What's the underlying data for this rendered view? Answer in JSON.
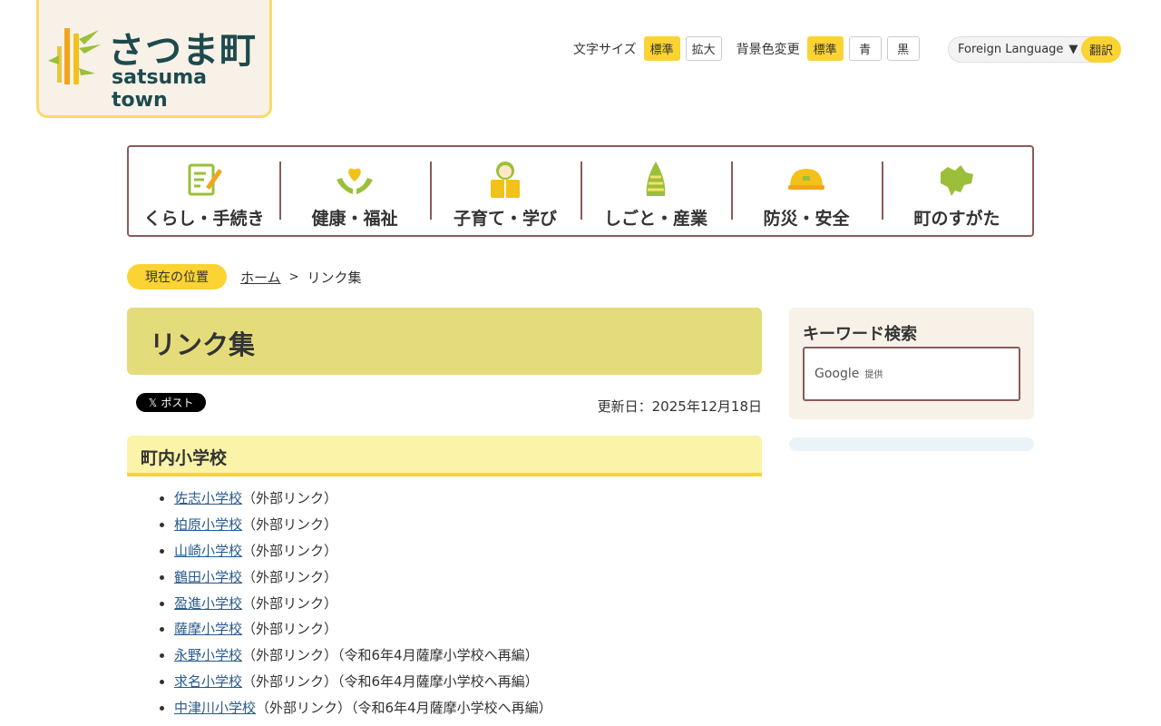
{
  "logo": {
    "name_jp": "さつま町",
    "name_en": "satsuma town"
  },
  "header": {
    "font_size_label": "文字サイズ",
    "font_size_standard": "標準",
    "font_size_large": "拡大",
    "bg_label": "背景色変更",
    "bg_standard": "標準",
    "bg_blue": "青",
    "bg_black": "黒",
    "language_select": "Foreign Language",
    "translate_button": "翻訳"
  },
  "gnav": {
    "items": [
      {
        "label": "くらし・手続き",
        "icon": "form-icon"
      },
      {
        "label": "健康・福祉",
        "icon": "heart-hands-icon"
      },
      {
        "label": "子育て・学び",
        "icon": "child-book-icon"
      },
      {
        "label": "しごと・産業",
        "icon": "bamboo-shoot-icon"
      },
      {
        "label": "防災・安全",
        "icon": "helmet-icon"
      },
      {
        "label": "町のすがた",
        "icon": "town-map-icon"
      }
    ]
  },
  "breadcrumb": {
    "tag": "現在の位置",
    "home": "ホーム",
    "current": "リンク集"
  },
  "main": {
    "title": "リンク集",
    "x_post": "ポスト",
    "updated": "更新日：2025年12月18日",
    "section_title": "町内小学校",
    "links": [
      {
        "name": "佐志小学校",
        "note": "（外部リンク）"
      },
      {
        "name": "柏原小学校",
        "note": "（外部リンク）"
      },
      {
        "name": "山崎小学校",
        "note": "（外部リンク）"
      },
      {
        "name": "鶴田小学校",
        "note": "（外部リンク）"
      },
      {
        "name": "盈進小学校",
        "note": "（外部リンク）"
      },
      {
        "name": "薩摩小学校",
        "note": "（外部リンク）"
      },
      {
        "name": "永野小学校",
        "note": "（外部リンク）（令和6年4月薩摩小学校へ再編）"
      },
      {
        "name": "求名小学校",
        "note": "（外部リンク）（令和6年4月薩摩小学校へ再編）"
      },
      {
        "name": "中津川小学校",
        "note": "（外部リンク）（令和6年4月薩摩小学校へ再編）"
      }
    ]
  },
  "sidebar": {
    "search_title": "キーワード検索",
    "google_label": "Google",
    "provided": "提供"
  },
  "colors": {
    "accent": "#fbd332",
    "title_bg": "#e4dc7a",
    "section_bg": "#fbf3a8",
    "border": "#8a5a5a",
    "link": "#2a5a8c"
  }
}
